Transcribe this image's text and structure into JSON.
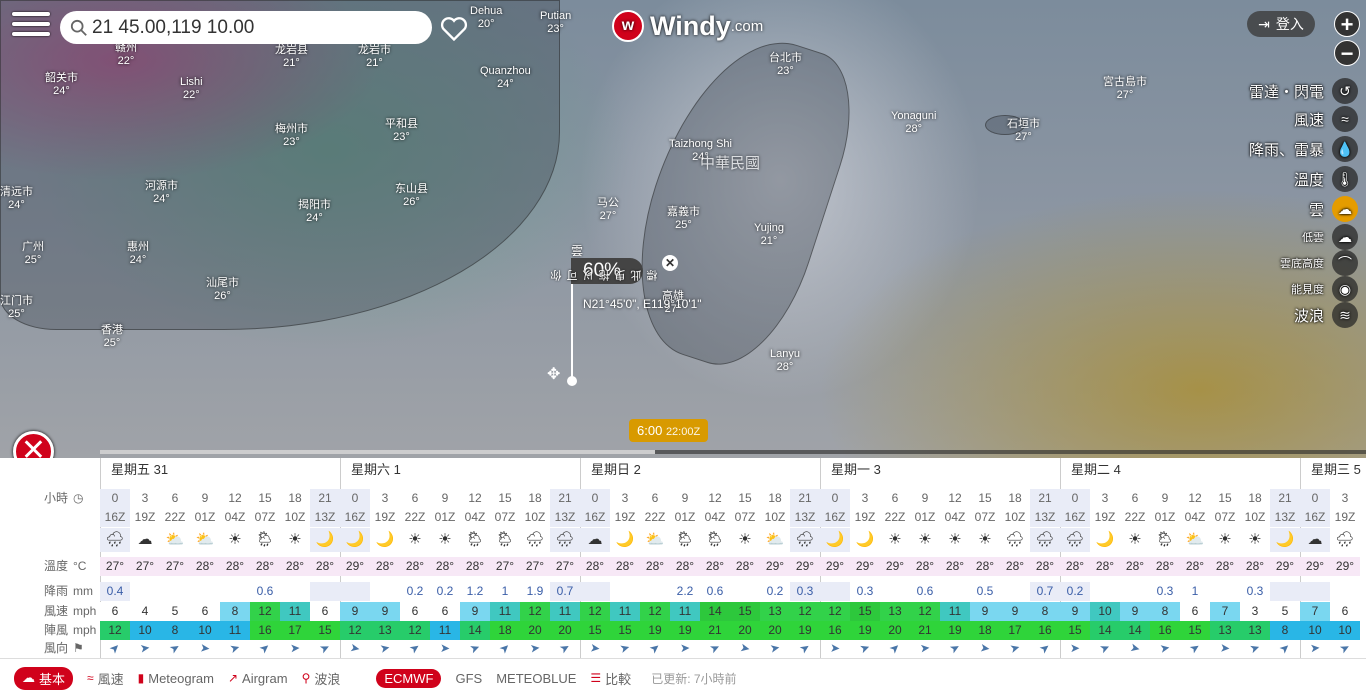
{
  "search": {
    "value": "21 45.00,119 10.00"
  },
  "logo": {
    "text": "Windy",
    "suffix": ".com"
  },
  "login": {
    "label": "登入"
  },
  "zoom": {
    "in": "+",
    "out": "−"
  },
  "cities": [
    {
      "name": "韶关市",
      "temp": "24°"
    },
    {
      "name": "赣州",
      "temp": "22°"
    },
    {
      "name": "龙岩县",
      "temp": "21°"
    },
    {
      "name": "龙岩市",
      "temp": "21°"
    },
    {
      "name": "Dehua",
      "temp": "20°"
    },
    {
      "name": "Putian",
      "temp": "23°"
    },
    {
      "name": "Quanzhou",
      "temp": "24°"
    },
    {
      "name": "Lishi",
      "temp": "22°"
    },
    {
      "name": "梅州市",
      "temp": "23°"
    },
    {
      "name": "平和县",
      "temp": "23°"
    },
    {
      "name": "河源市",
      "temp": "24°"
    },
    {
      "name": "清远市",
      "temp": "24°"
    },
    {
      "name": "揭阳市",
      "temp": "24°"
    },
    {
      "name": "东山县",
      "temp": "26°"
    },
    {
      "name": "马公",
      "temp": "27°"
    },
    {
      "name": "广州",
      "temp": "25°"
    },
    {
      "name": "惠州",
      "temp": "24°"
    },
    {
      "name": "汕尾市",
      "temp": "26°"
    },
    {
      "name": "江门市",
      "temp": "25°"
    },
    {
      "name": "香港",
      "temp": "25°"
    },
    {
      "name": "台北市",
      "temp": "23°"
    },
    {
      "name": "Taizhong Shi",
      "temp": "24°"
    },
    {
      "name": "嘉義市",
      "temp": "25°"
    },
    {
      "name": "Yujing",
      "temp": "21°"
    },
    {
      "name": "高雄",
      "temp": "27°"
    },
    {
      "name": "Lanyu",
      "temp": "28°"
    },
    {
      "name": "Yonaguni",
      "temp": "28°"
    },
    {
      "name": "石垣市",
      "temp": "27°"
    },
    {
      "name": "宮古島市",
      "temp": "27°"
    }
  ],
  "country_label": "中華民國",
  "layers": [
    {
      "label": "雷達・閃電",
      "icon": "radar-icon"
    },
    {
      "label": "風速",
      "icon": "wind-icon"
    },
    {
      "label": "降雨、雷暴",
      "icon": "rain-icon"
    },
    {
      "label": "溫度",
      "icon": "thermometer-icon"
    },
    {
      "label": "雲",
      "icon": "cloud-icon",
      "active": true
    },
    {
      "label": "低雲",
      "icon": "low-cloud-icon"
    },
    {
      "label": "雲底高度",
      "icon": "cloud-base-icon"
    },
    {
      "label": "能見度",
      "icon": "eye-icon"
    },
    {
      "label": "波浪",
      "icon": "waves-icon"
    }
  ],
  "popup": {
    "layer": "雲",
    "value": "60%",
    "coords": "N21°45'0\", E119°10'1\"",
    "hint": "你可以拖曳此標"
  },
  "timebadge": {
    "time": "6:00",
    "zulu": "22:00Z"
  },
  "forecast": {
    "days": [
      "星期五 31",
      "星期六 1",
      "星期日 2",
      "星期一 3",
      "星期二 4",
      "星期三 5"
    ],
    "labels": {
      "hours": "小時",
      "temp": "溫度",
      "temp_unit": "°C",
      "rain": "降雨",
      "rain_unit": "mm",
      "wind": "風速",
      "wind_unit": "mph",
      "gust": "陣風",
      "gust_unit": "mph",
      "dir": "風向"
    },
    "hours": [
      "0",
      "3",
      "6",
      "9",
      "12",
      "15",
      "18",
      "21",
      "0",
      "3",
      "6",
      "9",
      "12",
      "15",
      "18",
      "21",
      "0",
      "3",
      "6",
      "9",
      "12",
      "15",
      "18",
      "21",
      "0",
      "3",
      "6",
      "9",
      "12",
      "15",
      "18",
      "21",
      "0",
      "3",
      "6",
      "9",
      "12",
      "15",
      "18",
      "21",
      "0",
      "3"
    ],
    "zulu": [
      "16Z",
      "19Z",
      "22Z",
      "01Z",
      "04Z",
      "07Z",
      "10Z",
      "13Z",
      "16Z",
      "19Z",
      "22Z",
      "01Z",
      "04Z",
      "07Z",
      "10Z",
      "13Z",
      "16Z",
      "19Z",
      "22Z",
      "01Z",
      "04Z",
      "07Z",
      "10Z",
      "13Z",
      "16Z",
      "19Z",
      "22Z",
      "01Z",
      "04Z",
      "07Z",
      "10Z",
      "13Z",
      "16Z",
      "19Z",
      "22Z",
      "01Z",
      "04Z",
      "07Z",
      "10Z",
      "13Z",
      "16Z",
      "19Z"
    ],
    "icons": [
      "🌧",
      "☁",
      "⛅",
      "⛅",
      "☀",
      "🌦",
      "☀",
      "🌙",
      "🌙",
      "🌙",
      "☀",
      "☀",
      "🌦",
      "🌦",
      "🌧",
      "🌧",
      "☁",
      "🌙",
      "⛅",
      "🌦",
      "🌦",
      "☀",
      "⛅",
      "🌧",
      "🌙",
      "🌙",
      "☀",
      "☀",
      "☀",
      "☀",
      "🌧",
      "🌧",
      "🌧",
      "🌙",
      "☀",
      "🌦",
      "⛅",
      "☀",
      "☀",
      "🌙",
      "☁",
      "🌧"
    ],
    "temps": [
      "27°",
      "27°",
      "27°",
      "28°",
      "28°",
      "28°",
      "28°",
      "28°",
      "29°",
      "28°",
      "28°",
      "28°",
      "28°",
      "27°",
      "27°",
      "27°",
      "28°",
      "28°",
      "28°",
      "28°",
      "28°",
      "28°",
      "29°",
      "29°",
      "29°",
      "29°",
      "29°",
      "28°",
      "28°",
      "28°",
      "28°",
      "28°",
      "28°",
      "28°",
      "28°",
      "28°",
      "28°",
      "28°",
      "28°",
      "29°",
      "29°",
      "29°"
    ],
    "rain": [
      "0.4",
      "",
      "",
      "",
      "",
      "0.6",
      "",
      "",
      "",
      "",
      "0.2",
      "0.2",
      "1.2",
      "1",
      "1.9",
      "0.7",
      "",
      "",
      "",
      "2.2",
      "0.6",
      "",
      "0.2",
      "0.3",
      "",
      "0.3",
      "",
      "0.6",
      "",
      "0.5",
      "",
      "0.7",
      "0.2",
      "",
      "",
      "0.3",
      "1",
      "",
      "0.3",
      "",
      "",
      ""
    ],
    "wind": [
      "6",
      "4",
      "5",
      "6",
      "8",
      "12",
      "11",
      "6",
      "9",
      "9",
      "6",
      "6",
      "9",
      "11",
      "12",
      "11",
      "12",
      "11",
      "12",
      "11",
      "14",
      "15",
      "13",
      "12",
      "12",
      "15",
      "13",
      "12",
      "11",
      "9",
      "9",
      "8",
      "9",
      "10",
      "9",
      "8",
      "6",
      "7",
      "3",
      "5",
      "7",
      "6"
    ],
    "gust": [
      "12",
      "10",
      "8",
      "10",
      "11",
      "16",
      "17",
      "15",
      "12",
      "13",
      "12",
      "11",
      "14",
      "18",
      "20",
      "20",
      "15",
      "15",
      "19",
      "19",
      "21",
      "20",
      "20",
      "19",
      "16",
      "19",
      "20",
      "21",
      "19",
      "18",
      "17",
      "16",
      "15",
      "14",
      "14",
      "16",
      "15",
      "13",
      "13",
      "8",
      "10",
      "10"
    ]
  },
  "bottom": {
    "tabs": [
      "基本",
      "風速",
      "Meteogram",
      "Airgram",
      "波浪"
    ],
    "models": [
      "ECMWF",
      "GFS",
      "METEOBLUE"
    ],
    "compare": "比較",
    "updated": "已更新: 7小時前"
  },
  "colors": {
    "brand": "#d0021b",
    "accent": "#e59c00"
  }
}
